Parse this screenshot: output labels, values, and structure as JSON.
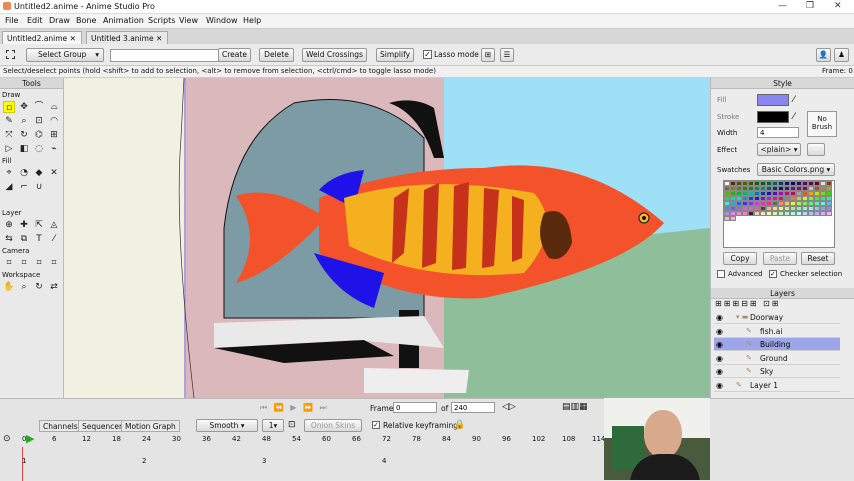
{
  "app": {
    "title": "Untitled2.anime - Anime Studio Pro"
  },
  "menu": [
    "File",
    "Edit",
    "Draw",
    "Bone",
    "Animation",
    "Scripts",
    "View",
    "Window",
    "Help"
  ],
  "doc_tabs": [
    "Untitled2.anime",
    "Untitled 3.anime"
  ],
  "tool_options": {
    "select_group": "Select Group",
    "create": "Create",
    "delete": "Delete",
    "weld": "Weld Crossings",
    "simplify": "Simplify",
    "lasso": "Lasso mode"
  },
  "status": {
    "hint": "Select/deselect points (hold <shift> to add to selection, <alt> to remove from selection, <ctrl/cmd> to toggle lasso mode)",
    "frame": "Frame: 0"
  },
  "tools": {
    "title": "Tools",
    "draw": "Draw",
    "fill": "Fill",
    "layer": "Layer",
    "camera": "Camera",
    "workspace": "Workspace"
  },
  "style": {
    "title": "Style",
    "fill": "Fill",
    "stroke": "Stroke",
    "width_label": "Width",
    "width_value": "4",
    "no_brush": "No Brush",
    "effect_label": "Effect",
    "effect_value": "<plain>",
    "swatches_label": "Swatches",
    "swatches_value": "Basic Colors.png",
    "copy": "Copy",
    "paste": "Paste",
    "reset": "Reset",
    "advanced": "Advanced",
    "checker": "Checker selection",
    "fill_color": "#8a86f0",
    "stroke_color": "#000000"
  },
  "layers": {
    "title": "Layers",
    "items": [
      {
        "name": "Doorway",
        "indent": 1,
        "type": "folder"
      },
      {
        "name": "fish.ai",
        "indent": 2,
        "type": "layer"
      },
      {
        "name": "Building",
        "indent": 2,
        "type": "layer",
        "selected": true
      },
      {
        "name": "Ground",
        "indent": 2,
        "type": "layer"
      },
      {
        "name": "Sky",
        "indent": 2,
        "type": "layer"
      },
      {
        "name": "Layer 1",
        "indent": 1,
        "type": "layer"
      }
    ]
  },
  "timeline": {
    "frame_label": "Frame",
    "frame_value": "0",
    "of_label": "of",
    "total": "240",
    "tabs": [
      "Channels",
      "Sequencer",
      "Motion Graph"
    ],
    "interp": "Smooth",
    "interp_n": "1",
    "onion": "Onion Skins",
    "relative": "Relative keyframing",
    "ticks": [
      "0",
      "6",
      "12",
      "18",
      "24",
      "30",
      "36",
      "42",
      "48",
      "54",
      "60",
      "66",
      "72",
      "78",
      "84",
      "90",
      "96",
      "102",
      "108",
      "114"
    ],
    "lower_ticks": [
      "1",
      "2",
      "3",
      "4"
    ]
  }
}
